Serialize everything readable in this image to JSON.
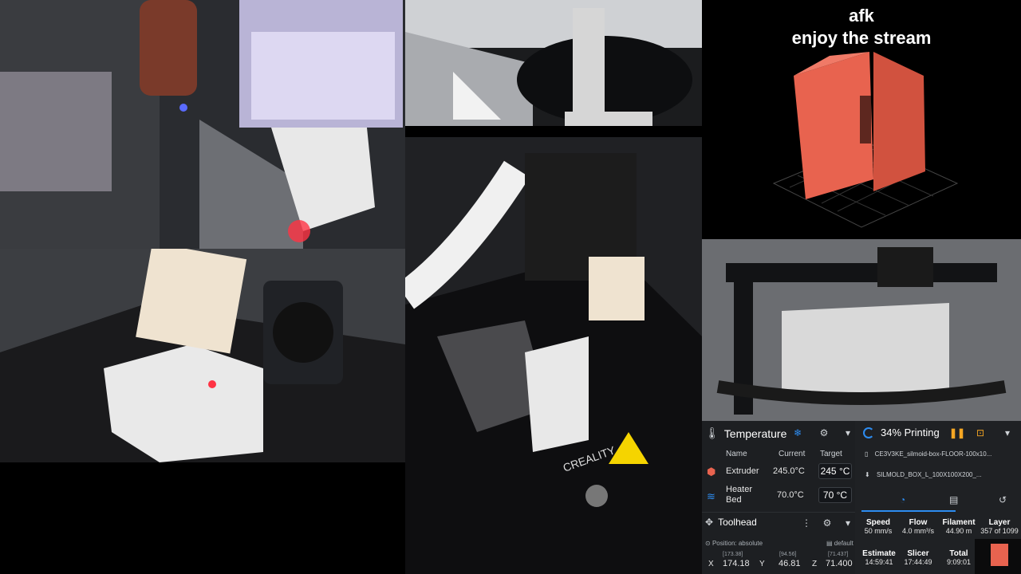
{
  "overlay": {
    "line1": "afk",
    "line2": "enjoy the stream"
  },
  "temperature": {
    "title": "Temperature",
    "col_name": "Name",
    "col_current": "Current",
    "col_target": "Target",
    "rows": [
      {
        "name": "Extruder",
        "current": "245.0°C",
        "target": "245",
        "unit": "°C"
      },
      {
        "name": "Heater\nBed",
        "name1": "Heater",
        "name2": "Bed",
        "current": "70.0°C",
        "target": "70",
        "unit": "°C"
      }
    ]
  },
  "toolhead": {
    "title": "Toolhead",
    "position_label": "Position: absolute",
    "default_label": "default",
    "axes": [
      {
        "axis": "X",
        "value": "174.18",
        "commanded": "[173.38]"
      },
      {
        "axis": "Y",
        "value": "46.81",
        "commanded": "[94.56]"
      },
      {
        "axis": "Z",
        "value": "71.400",
        "commanded": "[71.437]"
      }
    ]
  },
  "status": {
    "title": "34% Printing",
    "file": "CE3V3KE_silmoid-box-FLOOR-100x10...",
    "object": "SILMOLD_BOX_L_100X100X200_...",
    "stats": [
      {
        "label": "Speed",
        "value": "50 mm/s"
      },
      {
        "label": "Flow",
        "value": "4.0 mm³/s"
      },
      {
        "label": "Filament",
        "value": "44.90 m"
      },
      {
        "label": "Layer",
        "value": "357 of 1099"
      }
    ],
    "times": [
      {
        "label": "Estimate",
        "value": "14:59:41"
      },
      {
        "label": "Slicer",
        "value": "17:44:49"
      },
      {
        "label": "Total",
        "value": "9:09:01"
      }
    ]
  },
  "printer_bed_label": "CREALITY",
  "colors": {
    "panel_bg": "#1d1f22",
    "accent": "#2d8cf0",
    "pause": "#f5a623",
    "model": "#e8634f"
  }
}
